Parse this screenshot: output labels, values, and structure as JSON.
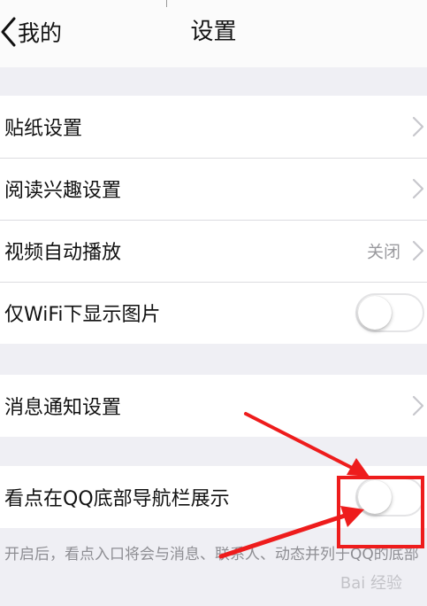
{
  "navbar": {
    "back_label": "我的",
    "title": "设置"
  },
  "group1": {
    "items": [
      {
        "label": "贴纸设置"
      },
      {
        "label": "阅读兴趣设置"
      },
      {
        "label": "视频自动播放",
        "value": "关闭"
      },
      {
        "label": "仅WiFi下显示图片",
        "toggle": false
      }
    ]
  },
  "group2": {
    "items": [
      {
        "label": "消息通知设置"
      }
    ]
  },
  "group3": {
    "items": [
      {
        "label": "看点在QQ底部导航栏展示",
        "toggle": false
      }
    ]
  },
  "footnote": "开启后，看点入口将会与消息、联系人、动态并列于QQ的底部",
  "annotation": {
    "highlight_color": "#ee1c1c"
  },
  "watermark": "Bai 经验"
}
